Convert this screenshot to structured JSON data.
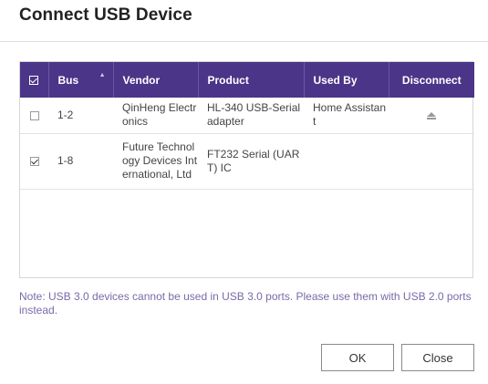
{
  "dialog": {
    "title": "Connect USB Device"
  },
  "table": {
    "columns": {
      "bus": "Bus",
      "vendor": "Vendor",
      "product": "Product",
      "used_by": "Used By",
      "disconnect": "Disconnect"
    },
    "header_checked": true,
    "rows": [
      {
        "checked": false,
        "bus": "1-2",
        "vendor": "QinHeng Electronics",
        "product": "HL-340 USB-Serial adapter",
        "used_by": "Home Assistant",
        "disconnect_icon": "eject-icon"
      },
      {
        "checked": true,
        "bus": "1-8",
        "vendor": "Future Technology Devices International, Ltd",
        "product": "FT232 Serial (UART) IC",
        "used_by": "",
        "disconnect_icon": ""
      }
    ]
  },
  "note": "Note: USB 3.0 devices cannot be used in USB 3.0 ports. Please use them with USB 2.0 ports instead.",
  "buttons": {
    "ok": "OK",
    "close": "Close"
  },
  "colors": {
    "header_bg": "#4b3588",
    "note_text": "#7a6aa8",
    "accent": "#4b3588"
  }
}
